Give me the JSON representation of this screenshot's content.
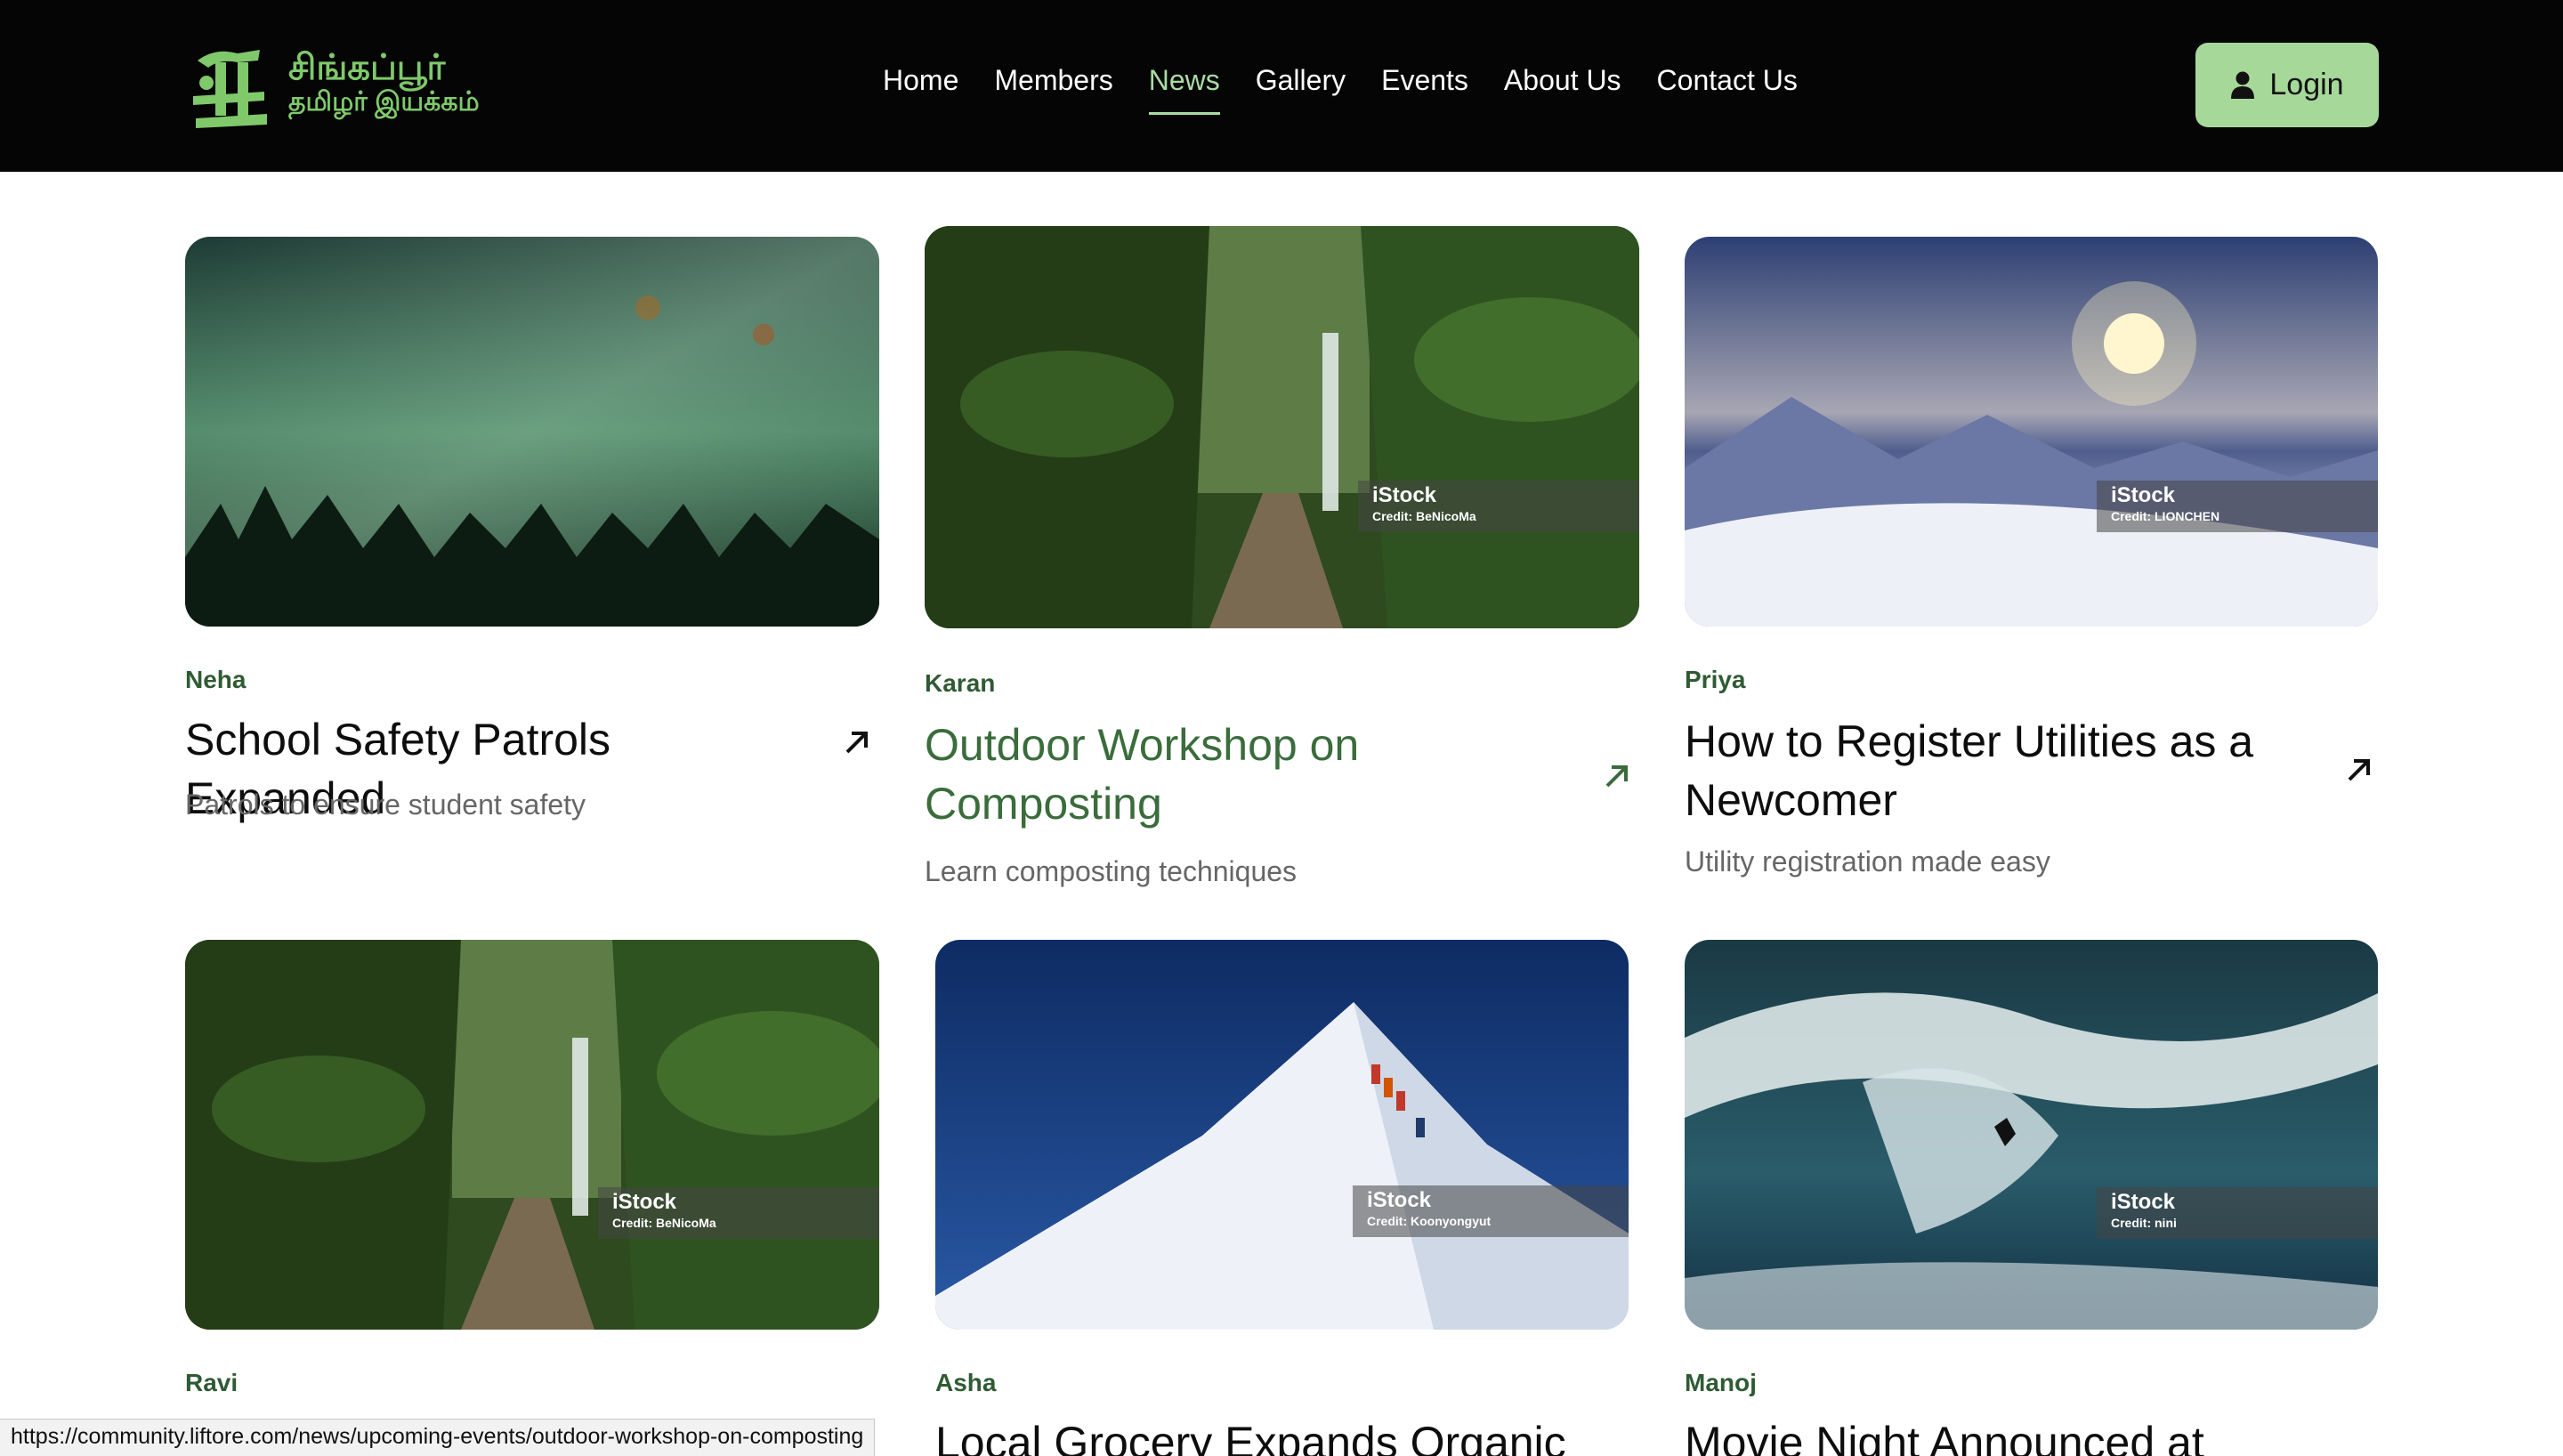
{
  "header": {
    "logo": {
      "line1": "சிங்கப்பூர்",
      "line2": "தமிழர் இயக்கம்"
    },
    "nav": [
      {
        "label": "Home"
      },
      {
        "label": "Members"
      },
      {
        "label": "News",
        "active": true
      },
      {
        "label": "Gallery"
      },
      {
        "label": "Events"
      },
      {
        "label": "About Us"
      },
      {
        "label": "Contact Us"
      }
    ],
    "login_label": "Login"
  },
  "cards": [
    {
      "author": "Neha",
      "title": "School Safety Patrols Expanded",
      "description": "Patrols to ensure student safety",
      "image": "misty-forest"
    },
    {
      "author": "Karan",
      "title": "Outdoor Workshop on Composting",
      "description": "Learn composting techniques",
      "image": "jungle-waterfall",
      "watermark": {
        "brand": "iStock",
        "credit": "Credit: BeNicoMa"
      },
      "hovered": true
    },
    {
      "author": "Priya",
      "title": "How to Register Utilities as a Newcomer",
      "description": "Utility registration made easy",
      "image": "snowy-mountains",
      "watermark": {
        "brand": "iStock",
        "credit": "Credit: LIONCHEN"
      }
    },
    {
      "author": "Ravi",
      "title": "",
      "description": "",
      "image": "jungle-waterfall",
      "watermark": {
        "brand": "iStock",
        "credit": "Credit: BeNicoMa"
      }
    },
    {
      "author": "Asha",
      "title": "Local Grocery Expands Organic",
      "description": "",
      "image": "snow-peak-climbers",
      "watermark": {
        "brand": "iStock",
        "credit": "Credit: Koonyongyut"
      }
    },
    {
      "author": "Manoj",
      "title": "Movie Night Announced at",
      "description": "",
      "image": "big-wave-surfer",
      "watermark": {
        "brand": "iStock",
        "credit": "Credit: nini"
      }
    }
  ],
  "status_url": "https://community.liftore.com/news/upcoming-events/outdoor-workshop-on-composting",
  "colors": {
    "header_bg": "#050505",
    "accent_green": "#a6d89a",
    "author_green": "#2f5b34",
    "hover_title": "#3a6c3c"
  }
}
